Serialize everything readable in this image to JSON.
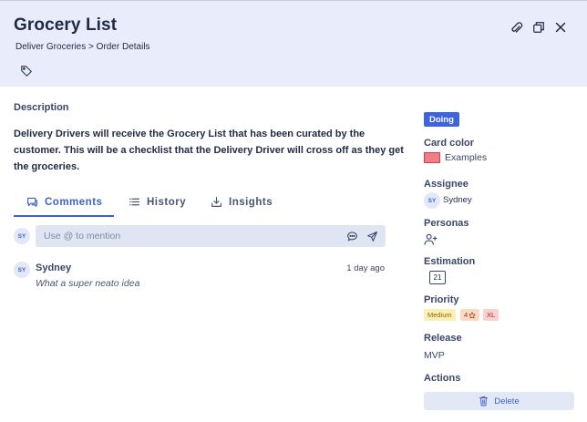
{
  "header": {
    "title": "Grocery List",
    "breadcrumb": "Deliver Groceries > Order Details"
  },
  "description": {
    "label": "Description",
    "text": "Delivery Drivers will receive the Grocery List that has been curated by the customer. This will be a checklist that the Delivery Driver will cross off as they get the groceries."
  },
  "tabs": [
    {
      "label": "Comments",
      "active": true
    },
    {
      "label": "History",
      "active": false
    },
    {
      "label": "Insights",
      "active": false
    }
  ],
  "comment_box": {
    "avatar": "SY",
    "placeholder": "Use @ to mention"
  },
  "comments": [
    {
      "avatar": "SY",
      "author": "Sydney",
      "time": "1 day ago",
      "body": "What a super neato idea"
    }
  ],
  "sidebar": {
    "status": "Doing",
    "card_color": {
      "label": "Card color",
      "value": "Examples",
      "color": "#f27d86"
    },
    "assignee": {
      "label": "Assignee",
      "avatar": "SY",
      "name": "Sydney"
    },
    "personas": {
      "label": "Personas"
    },
    "estimation": {
      "label": "Estimation",
      "value": "21"
    },
    "priority": {
      "label": "Priority",
      "level": "Medium",
      "points": "4",
      "size": "XL"
    },
    "release": {
      "label": "Release",
      "value": "MVP"
    },
    "actions": {
      "label": "Actions",
      "delete_label": "Delete"
    }
  },
  "colors": {
    "header_bg": "#e9edfb",
    "accent": "#3c63c8",
    "status_badge": "#3c63e0"
  }
}
